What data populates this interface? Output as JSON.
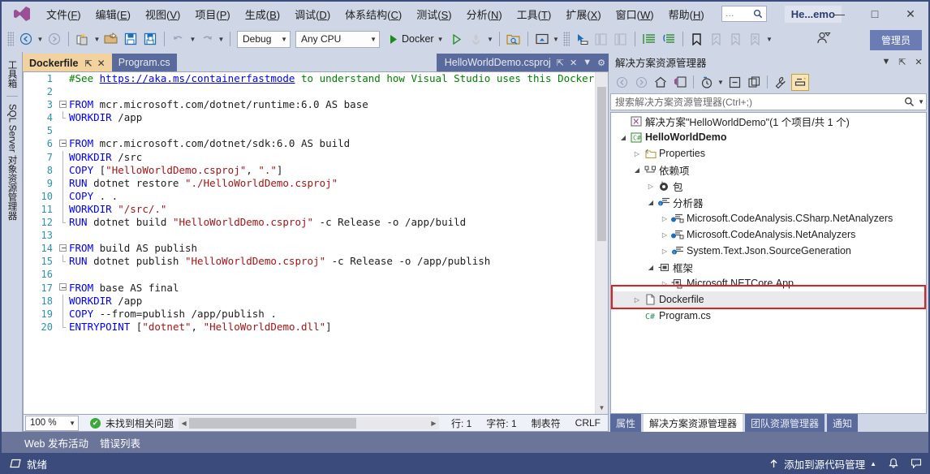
{
  "window": {
    "title": "He...emo",
    "search_placeholder": "…",
    "minimize": "—",
    "maximize": "□",
    "close": "✕"
  },
  "menubar": {
    "logo_name": "visual-studio-logo",
    "items": [
      {
        "label": "文件(F)",
        "key": "F"
      },
      {
        "label": "编辑(E)",
        "key": "E"
      },
      {
        "label": "视图(V)",
        "key": "V"
      },
      {
        "label": "项目(P)",
        "key": "P"
      },
      {
        "label": "生成(B)",
        "key": "B"
      },
      {
        "label": "调试(D)",
        "key": "D"
      },
      {
        "label": "体系结构(C)",
        "key": "C"
      },
      {
        "label": "测试(S)",
        "key": "S"
      },
      {
        "label": "分析(N)",
        "key": "N"
      },
      {
        "label": "工具(T)",
        "key": "T"
      },
      {
        "label": "扩展(X)",
        "key": "X"
      },
      {
        "label": "窗口(W)",
        "key": "W"
      },
      {
        "label": "帮助(H)",
        "key": "H"
      }
    ]
  },
  "toolbar": {
    "config": "Debug",
    "platform": "Any CPU",
    "run_label": "Docker",
    "admin_label": "管理员"
  },
  "tabs": {
    "active": {
      "label": "Dockerfile",
      "pin": "⇱",
      "close": "✕"
    },
    "inactive": [
      {
        "label": "Program.cs"
      }
    ],
    "right_doc": {
      "label": "HelloWorldDemo.csproj"
    }
  },
  "left_rail": {
    "items": [
      "工具箱",
      "SQL Server 对象资源管理器"
    ]
  },
  "editor": {
    "lines": [
      {
        "n": "1",
        "fold": "none",
        "tokens": [
          {
            "t": "#See ",
            "c": "c-cmt"
          },
          {
            "t": "https://aka.ms/containerfastmode",
            "c": "c-lnk"
          },
          {
            "t": " to understand how Visual Studio uses this Dockerfi",
            "c": "c-cmt"
          }
        ]
      },
      {
        "n": "2",
        "fold": "none",
        "tokens": []
      },
      {
        "n": "3",
        "fold": "start",
        "tokens": [
          {
            "t": "FROM",
            "c": "c-kw"
          },
          {
            "t": " mcr.microsoft.com/dotnet/runtime:6.0 AS base",
            "c": "c-txt"
          }
        ]
      },
      {
        "n": "4",
        "fold": "end",
        "tokens": [
          {
            "t": "WORKDIR",
            "c": "c-kw"
          },
          {
            "t": " /app",
            "c": "c-txt"
          }
        ]
      },
      {
        "n": "5",
        "fold": "none",
        "tokens": []
      },
      {
        "n": "6",
        "fold": "start",
        "tokens": [
          {
            "t": "FROM",
            "c": "c-kw"
          },
          {
            "t": " mcr.microsoft.com/dotnet/sdk:6.0 AS build",
            "c": "c-txt"
          }
        ]
      },
      {
        "n": "7",
        "fold": "mid",
        "tokens": [
          {
            "t": "WORKDIR",
            "c": "c-kw"
          },
          {
            "t": " /src",
            "c": "c-txt"
          }
        ]
      },
      {
        "n": "8",
        "fold": "mid",
        "tokens": [
          {
            "t": "COPY",
            "c": "c-kw"
          },
          {
            "t": " [",
            "c": "c-txt"
          },
          {
            "t": "\"HelloWorldDemo.csproj\"",
            "c": "c-str"
          },
          {
            "t": ", ",
            "c": "c-txt"
          },
          {
            "t": "\".\"",
            "c": "c-str"
          },
          {
            "t": "]",
            "c": "c-txt"
          }
        ]
      },
      {
        "n": "9",
        "fold": "mid",
        "tokens": [
          {
            "t": "RUN",
            "c": "c-kw"
          },
          {
            "t": " dotnet restore ",
            "c": "c-txt"
          },
          {
            "t": "\"./HelloWorldDemo.csproj\"",
            "c": "c-str"
          }
        ]
      },
      {
        "n": "10",
        "fold": "mid",
        "tokens": [
          {
            "t": "COPY",
            "c": "c-kw"
          },
          {
            "t": " . .",
            "c": "c-txt"
          }
        ]
      },
      {
        "n": "11",
        "fold": "mid",
        "tokens": [
          {
            "t": "WORKDIR",
            "c": "c-kw"
          },
          {
            "t": " ",
            "c": "c-txt"
          },
          {
            "t": "\"/src/.\"",
            "c": "c-str"
          }
        ]
      },
      {
        "n": "12",
        "fold": "end",
        "tokens": [
          {
            "t": "RUN",
            "c": "c-kw"
          },
          {
            "t": " dotnet build ",
            "c": "c-txt"
          },
          {
            "t": "\"HelloWorldDemo.csproj\"",
            "c": "c-str"
          },
          {
            "t": " -c Release -o /app/build",
            "c": "c-txt"
          }
        ]
      },
      {
        "n": "13",
        "fold": "none",
        "tokens": []
      },
      {
        "n": "14",
        "fold": "start",
        "tokens": [
          {
            "t": "FROM",
            "c": "c-kw"
          },
          {
            "t": " build AS publish",
            "c": "c-txt"
          }
        ]
      },
      {
        "n": "15",
        "fold": "end",
        "tokens": [
          {
            "t": "RUN",
            "c": "c-kw"
          },
          {
            "t": " dotnet publish ",
            "c": "c-txt"
          },
          {
            "t": "\"HelloWorldDemo.csproj\"",
            "c": "c-str"
          },
          {
            "t": " -c Release -o /app/publish",
            "c": "c-txt"
          }
        ]
      },
      {
        "n": "16",
        "fold": "none",
        "tokens": []
      },
      {
        "n": "17",
        "fold": "start",
        "tokens": [
          {
            "t": "FROM",
            "c": "c-kw"
          },
          {
            "t": " base AS final",
            "c": "c-txt"
          }
        ]
      },
      {
        "n": "18",
        "fold": "mid",
        "tokens": [
          {
            "t": "WORKDIR",
            "c": "c-kw"
          },
          {
            "t": " /app",
            "c": "c-txt"
          }
        ]
      },
      {
        "n": "19",
        "fold": "mid",
        "tokens": [
          {
            "t": "COPY",
            "c": "c-kw"
          },
          {
            "t": " --from=publish /app/publish .",
            "c": "c-txt"
          }
        ]
      },
      {
        "n": "20",
        "fold": "end",
        "tokens": [
          {
            "t": "ENTRYPOINT",
            "c": "c-kw"
          },
          {
            "t": " [",
            "c": "c-txt"
          },
          {
            "t": "\"dotnet\"",
            "c": "c-str"
          },
          {
            "t": ", ",
            "c": "c-txt"
          },
          {
            "t": "\"HelloWorldDemo.dll\"",
            "c": "c-str"
          },
          {
            "t": "]",
            "c": "c-txt"
          }
        ]
      }
    ],
    "footer": {
      "zoom": "100 %",
      "issues": "未找到相关问题",
      "line": "行: 1",
      "column": "字符: 1",
      "tabs_mode": "制表符",
      "eol": "CRLF"
    }
  },
  "solution_explorer": {
    "title": "解决方案资源管理器",
    "search_placeholder": "搜索解决方案资源管理器(Ctrl+;)",
    "tree": [
      {
        "depth": 0,
        "arrow": "none",
        "icon": "solution-icon",
        "label": "解决方案\"HelloWorldDemo\"(1 个项目/共 1 个)",
        "bold": false
      },
      {
        "depth": 0,
        "arrow": "open",
        "icon": "csharp-project-icon",
        "label": "HelloWorldDemo",
        "bold": true
      },
      {
        "depth": 1,
        "arrow": "closed",
        "icon": "properties-icon",
        "label": "Properties",
        "bold": false
      },
      {
        "depth": 1,
        "arrow": "open",
        "icon": "dependencies-icon",
        "label": "依赖项",
        "bold": false
      },
      {
        "depth": 2,
        "arrow": "closed",
        "icon": "package-icon",
        "label": "包",
        "bold": false
      },
      {
        "depth": 2,
        "arrow": "open",
        "icon": "analyzer-icon",
        "label": "分析器",
        "bold": false
      },
      {
        "depth": 3,
        "arrow": "closed",
        "icon": "analyzer-lock-icon",
        "label": "Microsoft.CodeAnalysis.CSharp.NetAnalyzers",
        "bold": false
      },
      {
        "depth": 3,
        "arrow": "closed",
        "icon": "analyzer-lock-icon",
        "label": "Microsoft.CodeAnalysis.NetAnalyzers",
        "bold": false
      },
      {
        "depth": 3,
        "arrow": "closed",
        "icon": "analyzer-icon",
        "label": "System.Text.Json.SourceGeneration",
        "bold": false
      },
      {
        "depth": 2,
        "arrow": "open",
        "icon": "framework-icon",
        "label": "框架",
        "bold": false
      },
      {
        "depth": 3,
        "arrow": "closed",
        "icon": "framework-ref-icon",
        "label": "Microsoft.NETCore.App",
        "bold": false
      },
      {
        "depth": 1,
        "arrow": "closed",
        "icon": "file-icon",
        "label": "Dockerfile",
        "bold": false,
        "selected": true
      },
      {
        "depth": 1,
        "arrow": "none",
        "icon": "csharp-file-icon",
        "label": "Program.cs",
        "bold": false
      }
    ],
    "highlight_color": "#e02020",
    "tabs": [
      {
        "label": "属性",
        "active": false
      },
      {
        "label": "解决方案资源管理器",
        "active": true
      },
      {
        "label": "团队资源管理器",
        "active": false
      },
      {
        "label": "通知",
        "active": false
      }
    ]
  },
  "bottom_tabs": [
    {
      "label": "Web 发布活动"
    },
    {
      "label": "错误列表"
    }
  ],
  "statusbar": {
    "ready": "就绪",
    "source_control": "添加到源代码管理",
    "bell": "🔔"
  },
  "colors": {
    "chrome": "#cfd6e5",
    "statusbar": "#3a4b7c",
    "accent": "#6b7cb5",
    "tab_active": "#f2d3a0",
    "tab_inactive": "#5a6a9c"
  }
}
